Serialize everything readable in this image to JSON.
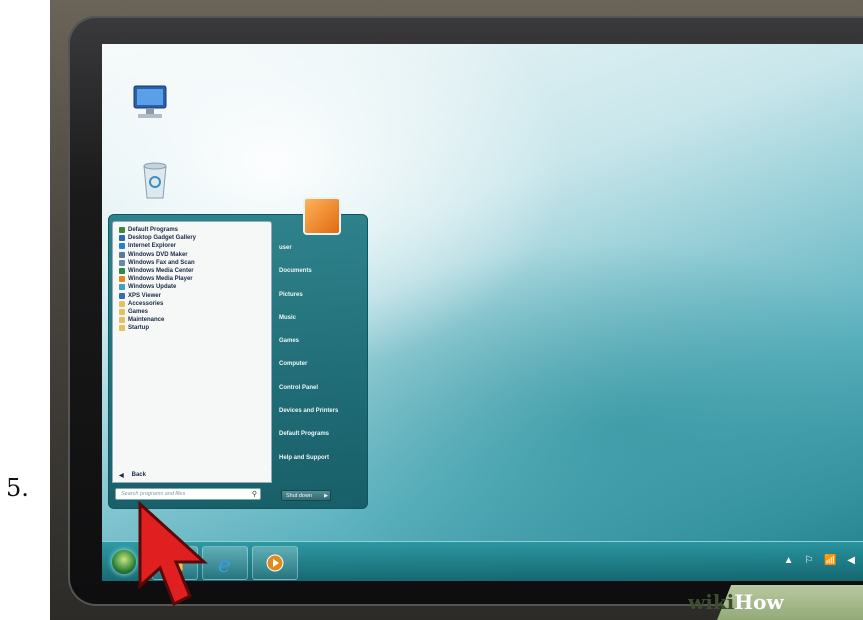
{
  "step_number": "5.",
  "start_menu": {
    "programs": [
      {
        "label": "Default Programs",
        "icon": "default-programs-icon",
        "color": "#3a8a3a"
      },
      {
        "label": "Desktop Gadget Gallery",
        "icon": "gadget-gallery-icon",
        "color": "#2a6ab0"
      },
      {
        "label": "Internet Explorer",
        "icon": "internet-explorer-icon",
        "color": "#2a80d0"
      },
      {
        "label": "Windows DVD Maker",
        "icon": "dvd-maker-icon",
        "color": "#5a7a9a"
      },
      {
        "label": "Windows Fax and Scan",
        "icon": "fax-scan-icon",
        "color": "#6a8aa0"
      },
      {
        "label": "Windows Media Center",
        "icon": "media-center-icon",
        "color": "#2a8a4a"
      },
      {
        "label": "Windows Media Player",
        "icon": "media-player-icon",
        "color": "#e08a20"
      },
      {
        "label": "Windows Update",
        "icon": "windows-update-icon",
        "color": "#3aa0d0"
      },
      {
        "label": "XPS Viewer",
        "icon": "xps-viewer-icon",
        "color": "#3a6ab0"
      },
      {
        "label": "Accessories",
        "icon": "folder-icon",
        "color": "#e8c060"
      },
      {
        "label": "Games",
        "icon": "folder-icon",
        "color": "#e8c060"
      },
      {
        "label": "Maintenance",
        "icon": "folder-icon",
        "color": "#e8c060"
      },
      {
        "label": "Startup",
        "icon": "folder-icon",
        "color": "#e8c060"
      }
    ],
    "back_label": "Back",
    "search_placeholder": "Search programs and files",
    "right_items": [
      "user",
      "Documents",
      "Pictures",
      "Music",
      "Games",
      "Computer",
      "Control Panel",
      "Devices and Printers",
      "Default Programs",
      "Help and Support"
    ],
    "shutdown_label": "Shut down"
  },
  "taskbar": {
    "tray_glyphs": "▲ ⚐ 📶 ◀"
  },
  "watermark": {
    "part1": "wiki",
    "part2": "How"
  }
}
